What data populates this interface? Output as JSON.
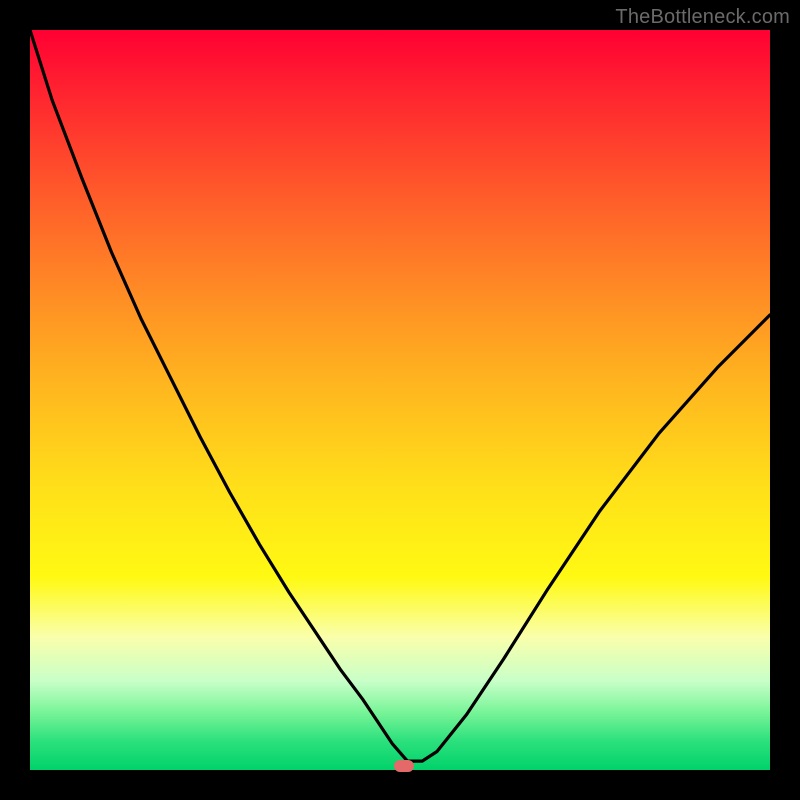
{
  "watermark": {
    "text": "TheBottleneck.com"
  },
  "marker": {
    "x_frac": 0.505,
    "y_frac": 0.994,
    "color": "#e46a6a"
  },
  "chart_data": {
    "type": "line",
    "title": "",
    "xlabel": "",
    "ylabel": "",
    "xlim": [
      0,
      1
    ],
    "ylim": [
      0,
      1
    ],
    "x": [
      0.0,
      0.03,
      0.07,
      0.11,
      0.15,
      0.19,
      0.23,
      0.27,
      0.31,
      0.35,
      0.39,
      0.42,
      0.45,
      0.47,
      0.49,
      0.51,
      0.53,
      0.55,
      0.59,
      0.64,
      0.7,
      0.77,
      0.85,
      0.93,
      1.0
    ],
    "y": [
      1.0,
      0.905,
      0.8,
      0.7,
      0.61,
      0.53,
      0.45,
      0.375,
      0.305,
      0.24,
      0.18,
      0.135,
      0.095,
      0.065,
      0.035,
      0.012,
      0.012,
      0.025,
      0.075,
      0.15,
      0.245,
      0.35,
      0.455,
      0.545,
      0.615
    ],
    "gradient_stops": [
      {
        "pos": 0.0,
        "color": "#ff0033"
      },
      {
        "pos": 0.5,
        "color": "#ffc01e"
      },
      {
        "pos": 0.75,
        "color": "#fff913"
      },
      {
        "pos": 0.9,
        "color": "#7cf59a"
      },
      {
        "pos": 1.0,
        "color": "#00d26a"
      }
    ]
  }
}
